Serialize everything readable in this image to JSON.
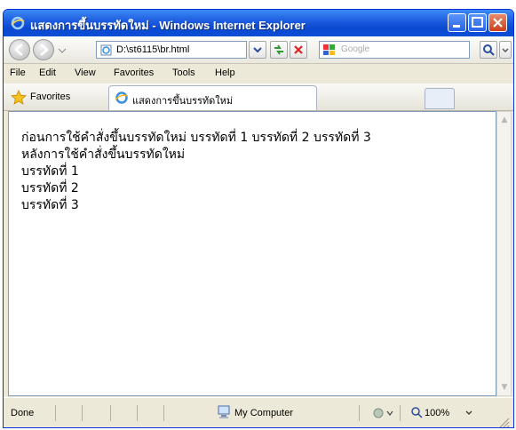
{
  "window": {
    "title": "แสดงการขึ้นบรรทัดใหม่ - Windows Internet Explorer",
    "controls": [
      "minimize",
      "maximize",
      "close"
    ]
  },
  "navbar": {
    "address": "D:\\st6115\\br.html",
    "search_placeholder": "Google",
    "icons": [
      "back-icon",
      "forward-icon",
      "page-icon",
      "refresh-icon",
      "stop-icon",
      "google-icon",
      "search-icon"
    ]
  },
  "menu": {
    "items": [
      "File",
      "Edit",
      "View",
      "Favorites",
      "Tools",
      "Help"
    ]
  },
  "favorites": {
    "label": "Favorites",
    "tab_title": "แสดงการขึ้นบรรทัดใหม่"
  },
  "content": {
    "lines": [
      "ก่อนการใช้คำสั่งขึ้นบรรทัดใหม่ บรรทัดที่ 1 บรรทัดที่ 2 บรรทัดที่ 3",
      "หลังการใช้คำสั่งขึ้นบรรทัดใหม่",
      "บรรทัดที่ 1",
      "บรรทัดที่ 2",
      "บรรทัดที่ 3"
    ]
  },
  "status": {
    "text": "Done",
    "zone": "My Computer",
    "zoom": "100%"
  },
  "colors": {
    "titlebar": "#0a48d0",
    "accent": "#3b8cf5",
    "close": "#c9401c"
  }
}
